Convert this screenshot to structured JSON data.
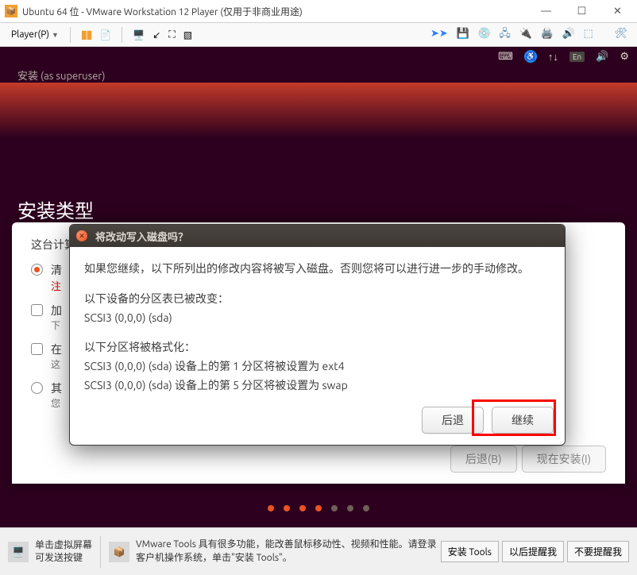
{
  "window": {
    "title": "Ubuntu 64 位 - VMware Workstation 12 Player (仅用于非商业用途)",
    "controls": {
      "min": "—",
      "max": "☐",
      "close": "✕"
    }
  },
  "vm_toolbar": {
    "player_menu": "Player(P)"
  },
  "guest_topbar": {
    "lang": "En"
  },
  "installer": {
    "superuser_line": "安装 (as superuser)",
    "page_title": "安装类型",
    "prompt": "这台计算",
    "option1_label": "清",
    "option1_note": "注",
    "option2_label": "加",
    "option2_sub": "下",
    "option3_label": "在",
    "option3_sub": "这",
    "option4_label": "其",
    "option4_sub": "您",
    "back_btn": "后退(B)",
    "install_btn": "现在安装(I)"
  },
  "dialog": {
    "title": "将改动写入磁盘吗？",
    "line1": "如果您继续，以下所列出的修改内容将被写入磁盘。否则您将可以进行进一步的手动修改。",
    "line2": "以下设备的分区表已被改变：",
    "line3": "SCSI3 (0,0,0) (sda)",
    "line4": "以下分区将被格式化：",
    "line5": "SCSI3 (0,0,0) (sda) 设备上的第 1 分区将被设置为 ext4",
    "line6": "SCSI3 (0,0,0) (sda) 设备上的第 5 分区将被设置为 swap",
    "back_btn": "后退",
    "continue_btn": "继续"
  },
  "statusbar": {
    "hint1": "单击虚拟屏幕",
    "hint2": "可发送按键",
    "tools_msg": "VMware Tools 具有很多功能，能改善鼠标移动性、视频和性能。请登录客户机操作系统，单击\"安装 Tools\"。",
    "install_tools_btn": "安装 Tools",
    "remind_later_btn": "以后提醒我",
    "never_remind_btn": "不要提醒我"
  }
}
